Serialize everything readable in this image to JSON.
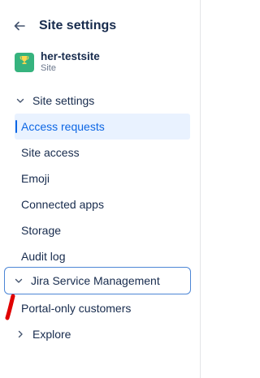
{
  "header": {
    "title": "Site settings",
    "back_icon": "arrow-left-icon"
  },
  "site": {
    "name": "her-testsite",
    "sub": "Site",
    "avatar_color": "#36b37e",
    "avatar_icon": "trophy-icon"
  },
  "nav": {
    "site_settings_group": "Site settings",
    "items": [
      "Access requests",
      "Site access",
      "Emoji",
      "Connected apps",
      "Storage",
      "Audit log"
    ],
    "active_index": 0,
    "jsm_group": "Jira Service Management",
    "jsm_items": [
      "Portal-only customers"
    ],
    "explore_group": "Explore"
  },
  "colors": {
    "active_text": "#0c66e4",
    "active_bg": "#e9f2ff",
    "focus_border": "#4c86d6",
    "annotation": "#e00000"
  }
}
